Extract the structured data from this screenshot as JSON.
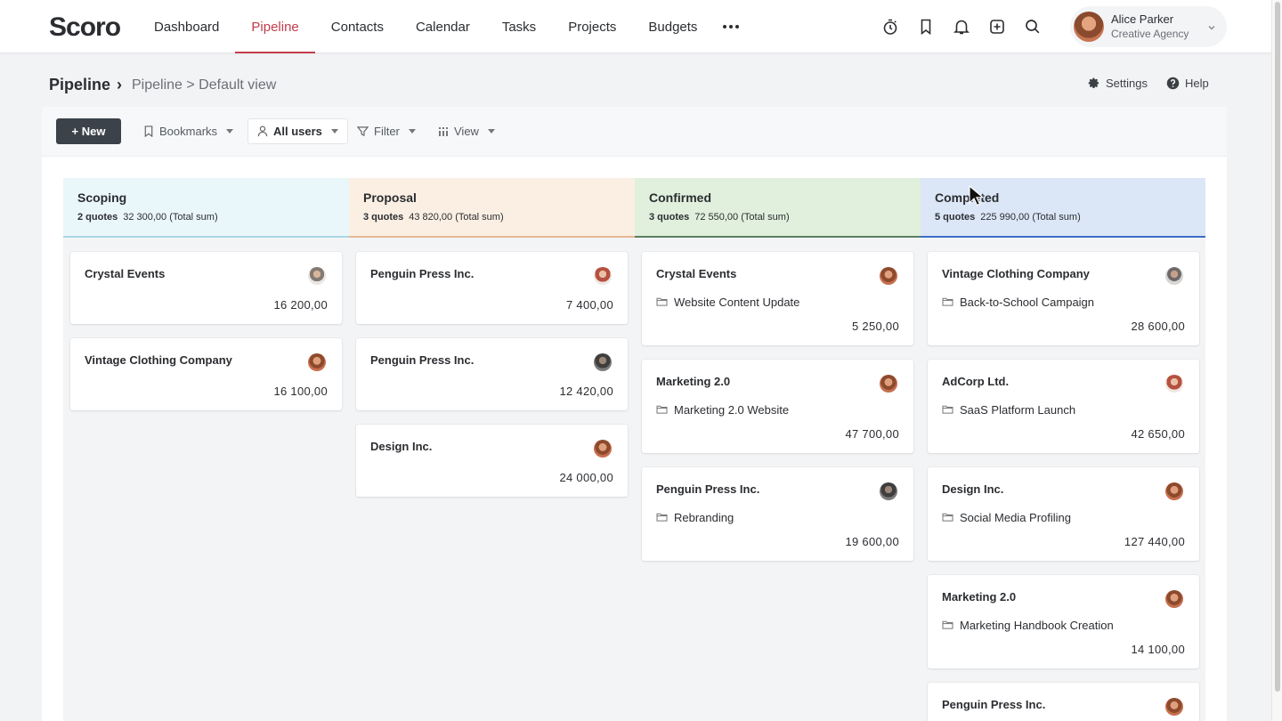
{
  "app": {
    "logo": "Scoro",
    "nav": [
      "Dashboard",
      "Pipeline",
      "Contacts",
      "Calendar",
      "Tasks",
      "Projects",
      "Budgets"
    ],
    "active_nav": "Pipeline",
    "user": {
      "name": "Alice Parker",
      "org": "Creative Agency"
    }
  },
  "header": {
    "title": "Pipeline",
    "separator": "›",
    "path": "Pipeline > Default view",
    "settings_label": "Settings",
    "help_label": "Help"
  },
  "toolbar": {
    "new_label": "+ New",
    "bookmarks_label": "Bookmarks",
    "users_label": "All users",
    "filter_label": "Filter",
    "view_label": "View"
  },
  "columns": [
    {
      "name": "Scoping",
      "count": "2 quotes",
      "total": "32 300,00 (Total sum)",
      "bg": "#eaf7fa",
      "accent": "#a9d9e6",
      "cards": [
        {
          "client": "Crystal Events",
          "project": "",
          "amount": "16 200,00",
          "avatar": "av-e"
        },
        {
          "client": "Vintage Clothing Company",
          "project": "",
          "amount": "16 100,00",
          "avatar": "av-a"
        }
      ]
    },
    {
      "name": "Proposal",
      "count": "3 quotes",
      "total": "43 820,00 (Total sum)",
      "bg": "#fbefe3",
      "accent": "#e6b894",
      "cards": [
        {
          "client": "Penguin Press Inc.",
          "project": "",
          "amount": "7 400,00",
          "avatar": "av-d"
        },
        {
          "client": "Penguin Press Inc.",
          "project": "",
          "amount": "12 420,00",
          "avatar": "av-c"
        },
        {
          "client": "Design Inc.",
          "project": "",
          "amount": "24 000,00",
          "avatar": "av-a"
        }
      ]
    },
    {
      "name": "Confirmed",
      "count": "3 quotes",
      "total": "72 550,00 (Total sum)",
      "bg": "#e0f0dc",
      "accent": "#5c7d63",
      "cards": [
        {
          "client": "Crystal Events",
          "project": "Website Content Update",
          "amount": "5 250,00",
          "avatar": "av-a"
        },
        {
          "client": "Marketing 2.0",
          "project": "Marketing 2.0 Website",
          "amount": "47 700,00",
          "avatar": "av-a"
        },
        {
          "client": "Penguin Press Inc.",
          "project": "Rebranding",
          "amount": "19 600,00",
          "avatar": "av-c"
        }
      ]
    },
    {
      "name": "Completed",
      "count": "5 quotes",
      "total": "225 990,00 (Total sum)",
      "bg": "#dbe6f7",
      "accent": "#3b6fc4",
      "cards": [
        {
          "client": "Vintage Clothing Company",
          "project": "Back-to-School Campaign",
          "amount": "28 600,00",
          "avatar": "av-b"
        },
        {
          "client": "AdCorp Ltd.",
          "project": "SaaS Platform Launch",
          "amount": "42 650,00",
          "avatar": "av-d"
        },
        {
          "client": "Design Inc.",
          "project": "Social Media Profiling",
          "amount": "127 440,00",
          "avatar": "av-a"
        },
        {
          "client": "Marketing 2.0",
          "project": "Marketing Handbook Creation",
          "amount": "14 100,00",
          "avatar": "av-a"
        },
        {
          "client": "Penguin Press Inc.",
          "project": "",
          "amount": "",
          "avatar": "av-a"
        }
      ]
    }
  ]
}
